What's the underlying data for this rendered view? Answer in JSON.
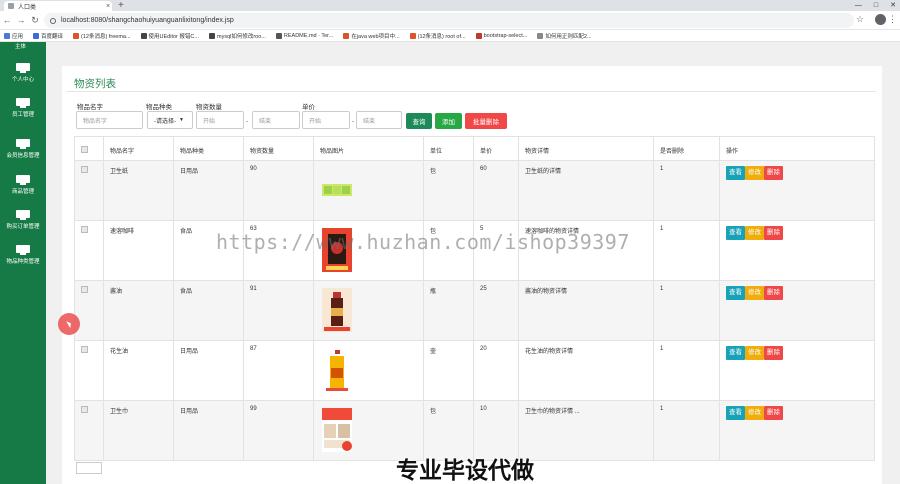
{
  "browser": {
    "tab_title": "人口类",
    "tab_close": "×",
    "new_tab": "+",
    "url": "localhost:8080/shangchaohuiyuanguanlixitong/index.jsp",
    "bookmarks": [
      {
        "label": "应用",
        "color": "#4a79d8"
      },
      {
        "label": "百度翻译",
        "color": "#3b6bd6"
      },
      {
        "label": "(12条消息) freema...",
        "color": "#d9532c"
      },
      {
        "label": "使用UEditor 报错C...",
        "color": "#444444"
      },
      {
        "label": "mysql如何修改roo...",
        "color": "#444444"
      },
      {
        "label": "README.md · Ter...",
        "color": "#555555"
      },
      {
        "label": "在java web项目中...",
        "color": "#d9532c"
      },
      {
        "label": "(12条消息) root of...",
        "color": "#d9532c"
      },
      {
        "label": "bootstrap-select...",
        "color": "#c0392b"
      },
      {
        "label": "如何用正则匹配2...",
        "color": "#888888"
      }
    ]
  },
  "sidebar": {
    "top_label": "主体",
    "items": [
      {
        "label": "个人中心"
      },
      {
        "label": "员工管理"
      },
      {
        "label": "会员信息管理"
      },
      {
        "label": "商品管理"
      },
      {
        "label": "购买订单管理"
      },
      {
        "label": "物品种类管理"
      }
    ]
  },
  "page": {
    "title": "物资列表",
    "filters": {
      "name_label": "物品名字",
      "name_placeholder": "物品名字",
      "type_label": "物品种类",
      "type_selected": "-请选择-",
      "qty_label": "物资数量",
      "qty_start_placeholder": "开始",
      "qty_end_placeholder": "结束",
      "price_label": "单价",
      "price_start_placeholder": "开始",
      "price_end_placeholder": "结束",
      "dash": "-"
    },
    "buttons": {
      "query": "查询",
      "add": "添加",
      "batch_delete": "批量删除"
    },
    "table": {
      "headers": [
        "物品名字",
        "物品种类",
        "物资数量",
        "物品图片",
        "单位",
        "单价",
        "物资详情",
        "是否删除",
        "操作"
      ],
      "action_labels": {
        "view": "查看",
        "edit": "修改",
        "delete": "删除"
      },
      "rows": [
        {
          "name": "卫生纸",
          "type": "日用品",
          "qty": "90",
          "unit": "包",
          "price": "60",
          "detail": "卫生纸的详情",
          "deleted": "1"
        },
        {
          "name": "速溶咖啡",
          "type": "食品",
          "qty": "63",
          "unit": "包",
          "price": "5",
          "detail": "速溶咖啡的物资详情",
          "deleted": "1"
        },
        {
          "name": "酱油",
          "type": "食品",
          "qty": "91",
          "unit": "瓶",
          "price": "25",
          "detail": "酱油的物资详情",
          "deleted": "1"
        },
        {
          "name": "花生油",
          "type": "日用品",
          "qty": "87",
          "unit": "壶",
          "price": "20",
          "detail": "花生油的物资详情",
          "deleted": "1"
        },
        {
          "name": "卫生巾",
          "type": "日用品",
          "qty": "99",
          "unit": "包",
          "price": "10",
          "detail": "卫生巾的物资详情 ...",
          "deleted": "1"
        }
      ]
    }
  },
  "overlay": {
    "watermark": "https://www.huzhan.com/ishop39397",
    "banner": "专业毕设代做"
  },
  "colors": {
    "sidebar": "#157a45",
    "title": "#2e8b57",
    "query_button": "#1e8a5a",
    "add_button": "#28a745",
    "batch_delete_button": "#f04848"
  }
}
